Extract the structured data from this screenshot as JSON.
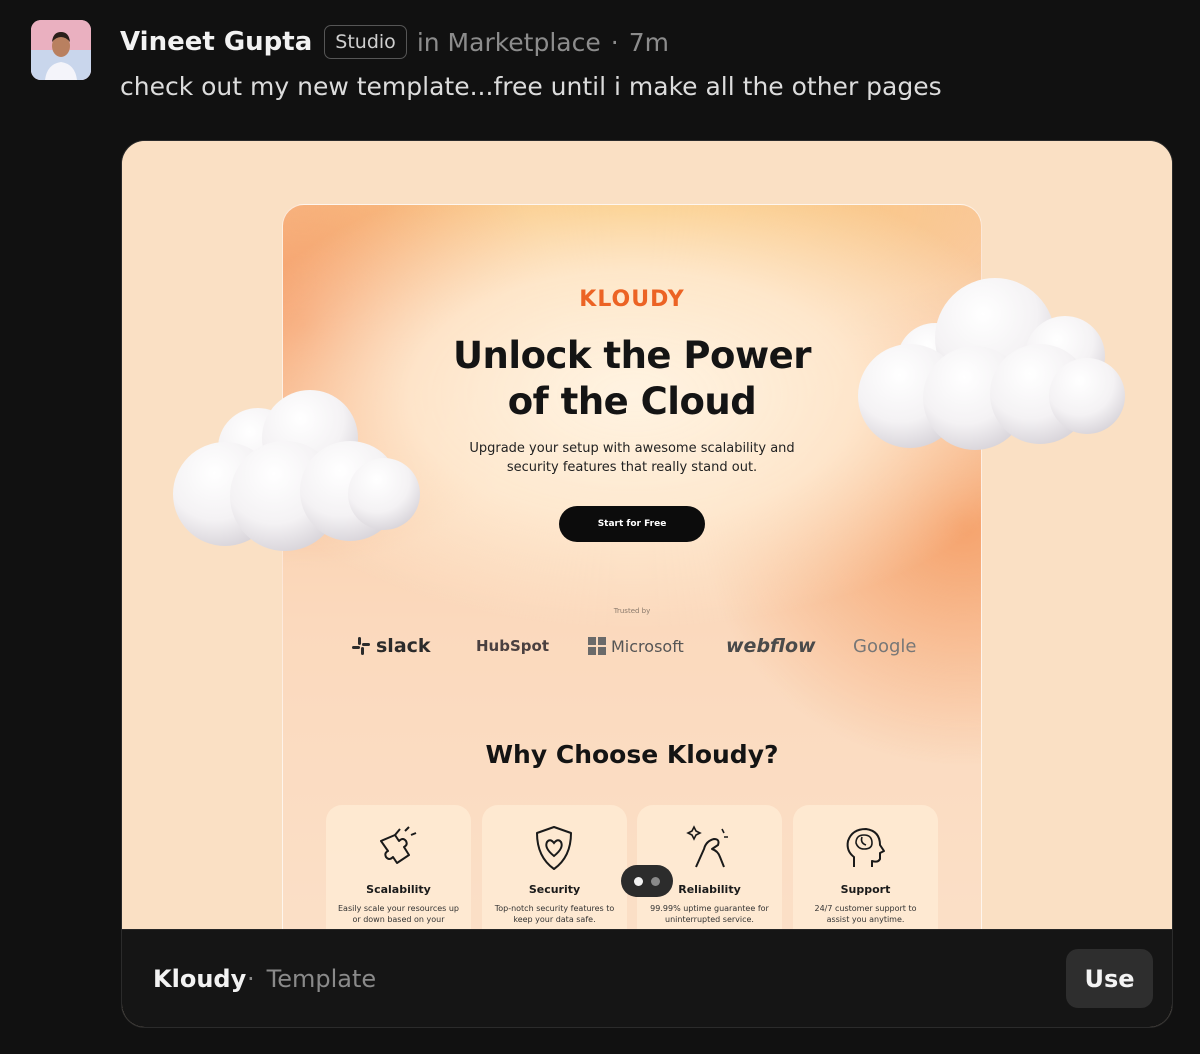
{
  "post": {
    "author": "Vineet Gupta",
    "badge": "Studio",
    "location": "in Marketplace",
    "separator": "·",
    "time": "7m",
    "text": "check out my new template...free until i make all the other pages"
  },
  "preview": {
    "brand": "KLOUDY",
    "hero_line1": "Unlock the Power",
    "hero_line2": "of the Cloud",
    "sub_line1": "Upgrade your setup with awesome scalability and",
    "sub_line2": "security features that really stand out.",
    "cta": "Start for Free",
    "trusted_by": "Trusted by",
    "logos": {
      "slack": "slack",
      "hubspot": "HubSpot",
      "microsoft": "Microsoft",
      "webflow": "webflow",
      "google": "Google"
    },
    "section_title": "Why Choose Kloudy?",
    "features": [
      {
        "title": "Scalability",
        "desc": "Easily scale your resources up or down based on your",
        "icon": "puzzle-icon"
      },
      {
        "title": "Security",
        "desc": "Top-notch security features to keep your data safe.",
        "icon": "shield-heart-icon"
      },
      {
        "title": "Reliability",
        "desc": "99.99% uptime guarantee for uninterrupted service.",
        "icon": "flexing-arm-icon"
      },
      {
        "title": "Support",
        "desc": "24/7 customer support to assist you anytime.",
        "icon": "head-brain-icon"
      }
    ],
    "carousel": {
      "total": 2,
      "active": 1
    }
  },
  "footer": {
    "template_name": "Kloudy",
    "separator": "·",
    "template_type": "Template",
    "use_label": "Use"
  },
  "colors": {
    "background": "#111111",
    "brand_orange": "#ec6324",
    "preview_bg": "#fae0c4"
  }
}
